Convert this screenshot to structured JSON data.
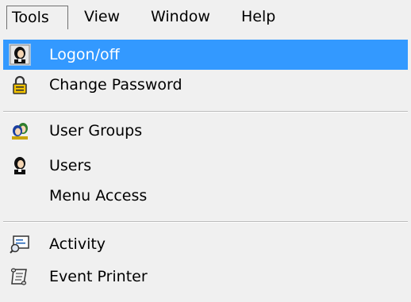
{
  "menubar": {
    "items": [
      {
        "label": "Tools"
      },
      {
        "label": "View"
      },
      {
        "label": "Window"
      },
      {
        "label": "Help"
      }
    ]
  },
  "tools_menu": {
    "groups": [
      [
        {
          "label": "Logon/off",
          "icon": "logon-icon"
        },
        {
          "label": "Change Password",
          "icon": "padlock-icon"
        }
      ],
      [
        {
          "label": "User Groups",
          "icon": "user-group-icon"
        },
        {
          "label": "Users",
          "icon": "user-icon"
        },
        {
          "label": "Menu Access",
          "icon": ""
        }
      ],
      [
        {
          "label": "Activity",
          "icon": "activity-monitor-icon"
        },
        {
          "label": "Event Printer",
          "icon": "scroll-icon"
        }
      ]
    ]
  },
  "colors": {
    "highlight": "#3399ff",
    "menu_background": "#f0f0f0"
  }
}
